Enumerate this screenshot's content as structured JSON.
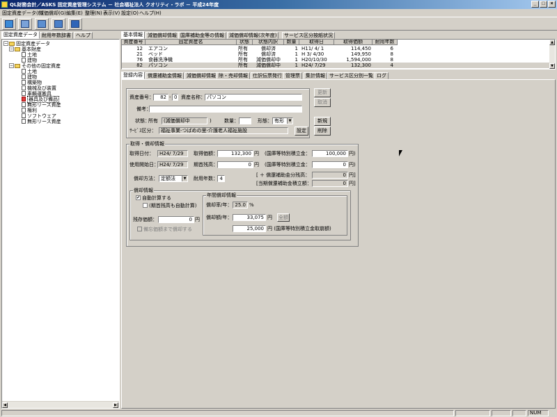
{
  "window": {
    "title": "QL財務会計／ASKS 固定資産管理システム － 社会福祉法人 クオリティ・ラボ － 平成24年度"
  },
  "menu": [
    "固定資産データ(F)",
    "減価償却(G)",
    "編集(E)",
    "整理(N)",
    "表示(V)",
    "設定(O)",
    "ヘルプ(H)"
  ],
  "left_tabs": [
    "固定資産データ",
    "耐用年数辞書",
    "ヘルプ"
  ],
  "tree": [
    {
      "label": "固定資産データ",
      "level": 0,
      "type": "folder",
      "exp": "−"
    },
    {
      "label": "基本財産",
      "level": 1,
      "type": "folder",
      "exp": "−"
    },
    {
      "label": "土地",
      "level": 2,
      "type": "page"
    },
    {
      "label": "建物",
      "level": 2,
      "type": "page"
    },
    {
      "label": "その他の固定資産",
      "level": 1,
      "type": "folder",
      "exp": "−"
    },
    {
      "label": "土地",
      "level": 2,
      "type": "page"
    },
    {
      "label": "建物",
      "level": 2,
      "type": "page"
    },
    {
      "label": "構築物",
      "level": 2,
      "type": "page"
    },
    {
      "label": "機械及び装置",
      "level": 2,
      "type": "page"
    },
    {
      "label": "車輌運搬具",
      "level": 2,
      "type": "page"
    },
    {
      "label": "器具及び備品",
      "level": 2,
      "type": "page",
      "selected": true
    },
    {
      "label": "無形リース資産",
      "level": 2,
      "type": "page"
    },
    {
      "label": "権利",
      "level": 2,
      "type": "page"
    },
    {
      "label": "ソフトウェア",
      "level": 2,
      "type": "page"
    },
    {
      "label": "無形リース資産",
      "level": 2,
      "type": "page"
    }
  ],
  "top_tabs": [
    "基本情報",
    "減価償却情報",
    "国庫補助金等の情報",
    "減価償却情報(次年度)",
    "サービス区分按紙状況"
  ],
  "table": {
    "headers": [
      "資産番号",
      "固定資産名",
      "状態",
      "状態内訳",
      "数量",
      "取得日",
      "取得価額",
      "耐用年数"
    ],
    "rows": [
      [
        "12",
        "エアコン",
        "所有",
        "償却済",
        "1",
        "H11/ 4/ 1",
        "114,450",
        "6"
      ],
      [
        "21",
        "ベッド",
        "所有",
        "償却済",
        "1",
        "H 3/ 4/30",
        "149,950",
        "8"
      ],
      [
        "76",
        "食器洗浄機",
        "所有",
        "減価償却中",
        "1",
        "H20/10/30",
        "1,594,000",
        "8"
      ],
      [
        "82",
        "パソコン",
        "所有",
        "減価償却中",
        "1",
        "H24/ 7/29",
        "132,300",
        "4"
      ]
    ]
  },
  "detail_tabs": [
    "登録内容",
    "償還補助金情報",
    "減価償却情報",
    "除・売却情報",
    "仕訳伝票発行",
    "管理票",
    "集計情報",
    "サービス区分別一覧",
    "ログ"
  ],
  "basic": {
    "asset_no_label": "資産番号：",
    "asset_no_a": "82",
    "asset_no_b": "0",
    "asset_name_label": "資産名称：",
    "asset_name": "パソコン",
    "memo_label": "備考：",
    "memo": "",
    "status_label": "状態：",
    "status": "所有",
    "status_detail": "(減価償却中",
    "status_detail_close": ")",
    "qty_label": "数量：",
    "qty": "",
    "form_label": "形態：",
    "form": "有形",
    "service_label": "ｻｰﾋﾞｽ区分：",
    "service": "福祉事業-つばめの里-介護老人福祉施設",
    "set_button": "設定"
  },
  "side_buttons": {
    "update": "更新",
    "cancel": "取消",
    "new": "新規",
    "delete": "削除"
  },
  "acquire": {
    "group_title": "取得・償却情報",
    "acq_date_label": "取得日付：",
    "acq_date": "H24/ 7/29",
    "acq_price_label": "取得価額：",
    "acq_price": "132,300",
    "yen": "円",
    "reserve_label": "(国庫等特別積立金：",
    "reserve_value": "100,000",
    "reserve_unit": "円)",
    "use_date_label": "使用開始日：",
    "use_date": "H24/ 7/29",
    "begin_bal_label": "期首残高：",
    "begin_bal": "0",
    "reserve2_label": "(国庫等特別積立金：",
    "reserve2_value": "0",
    "subsidy_bal_label": "[ ＋ 償還補助金分残高：",
    "subsidy_bal": "0",
    "subsidy_bal_unit": "円]",
    "method_label": "償却方法：",
    "method": "定額法",
    "life_label": "耐用年数：",
    "life": "4",
    "current_reserve_label": "[当期償還補助金積立額：",
    "current_reserve": "0",
    "current_reserve_unit": "円]"
  },
  "depr": {
    "group_title": "償却情報",
    "auto_calc": "自動計算する",
    "auto_calc_checked": "✔",
    "period_auto": "(期首残高も自動計算)",
    "residual_label": "残存価額：",
    "residual": "0",
    "residual_unit": "円",
    "to_memo": "備忘価額まで償却する",
    "annual_title": "年間償却情報",
    "rate_label": "償却率/年：",
    "rate": "25.0",
    "rate_unit": "%",
    "amount_label": "償却額/年：",
    "amount": "33,075",
    "amount_unit": "円",
    "all_button": "全額",
    "amount2": "25,000",
    "amount2_label": "円 (国庫等特別積立金取崩額)"
  },
  "status": {
    "num": "NUM"
  }
}
